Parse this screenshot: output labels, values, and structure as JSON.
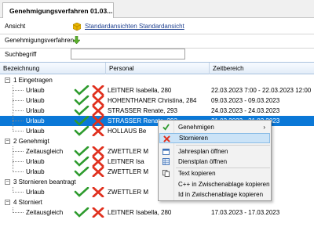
{
  "tab": {
    "title": "Genehmigungsverfahren 01.03...."
  },
  "filters": {
    "ansicht_label": "Ansicht",
    "ansicht_value": "Standardansichten Standardansicht",
    "genehmigungsverfahren_label": "Genehmigungsverfahren",
    "suchbegriff_label": "Suchbegriff",
    "suchbegriff_value": ""
  },
  "grid": {
    "columns": [
      "Bezeichnung",
      "Personal",
      "Zeitbereich"
    ],
    "groups": [
      {
        "label": "1 Eingetragen",
        "rows": [
          {
            "typ": "Urlaub",
            "personal": "LEITNER Isabella, 280",
            "zeitbereich": "22.03.2023  7:00 - 22.03.2023 12:00"
          },
          {
            "typ": "Urlaub",
            "personal": "HOHENTHANER Christina, 284",
            "zeitbereich": "09.03.2023 - 09.03.2023"
          },
          {
            "typ": "Urlaub",
            "personal": "STRASSER Renate, 293",
            "zeitbereich": "24.03.2023 - 24.03.2023"
          },
          {
            "typ": "Urlaub",
            "personal": "STRASSER Renate, 293",
            "zeitbereich": "31.03.2023 - 31.03.2023"
          },
          {
            "typ": "Urlaub",
            "personal": "HOLLAUS Be",
            "zeitbereich": ""
          }
        ]
      },
      {
        "label": "2 Genehmigt",
        "rows": [
          {
            "typ": "Zeitausgleich",
            "personal": "ZWETTLER M",
            "zeitbereich": ""
          },
          {
            "typ": "Urlaub",
            "personal": "LEITNER Isa",
            "zeitbereich": ""
          },
          {
            "typ": "Urlaub",
            "personal": "ZWETTLER M",
            "zeitbereich": ""
          }
        ]
      },
      {
        "label": "3 Stornieren beantragt",
        "rows": [
          {
            "typ": "Urlaub",
            "personal": "ZWETTLER M",
            "zeitbereich": ""
          }
        ]
      },
      {
        "label": "4 Storniert",
        "rows": [
          {
            "typ": "Zeitausgleich",
            "personal": "LEITNER Isabella, 280",
            "zeitbereich": "17.03.2023 - 17.03.2023"
          }
        ]
      }
    ]
  },
  "context_menu": {
    "items": [
      "Genehmigen",
      "Stornieren",
      "Jahresplan öffnen",
      "Dienstplan öffnen",
      "Text kopieren",
      "C++ in Zwischenablage kopieren",
      "Id in Zwischenablage kopieren"
    ],
    "submenu_arrow": "›"
  },
  "colors": {
    "selection": "#0b78d7",
    "link": "#1d3f8f",
    "check_green": "#2e9b2e",
    "cross_red": "#e0301e"
  }
}
